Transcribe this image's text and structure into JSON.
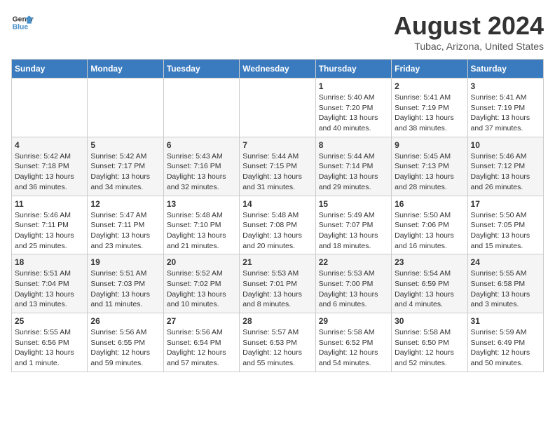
{
  "header": {
    "logo_line1": "General",
    "logo_line2": "Blue",
    "main_title": "August 2024",
    "subtitle": "Tubac, Arizona, United States"
  },
  "days_of_week": [
    "Sunday",
    "Monday",
    "Tuesday",
    "Wednesday",
    "Thursday",
    "Friday",
    "Saturday"
  ],
  "weeks": [
    [
      {
        "day": "",
        "info": ""
      },
      {
        "day": "",
        "info": ""
      },
      {
        "day": "",
        "info": ""
      },
      {
        "day": "",
        "info": ""
      },
      {
        "day": "1",
        "info": "Sunrise: 5:40 AM\nSunset: 7:20 PM\nDaylight: 13 hours\nand 40 minutes."
      },
      {
        "day": "2",
        "info": "Sunrise: 5:41 AM\nSunset: 7:19 PM\nDaylight: 13 hours\nand 38 minutes."
      },
      {
        "day": "3",
        "info": "Sunrise: 5:41 AM\nSunset: 7:19 PM\nDaylight: 13 hours\nand 37 minutes."
      }
    ],
    [
      {
        "day": "4",
        "info": "Sunrise: 5:42 AM\nSunset: 7:18 PM\nDaylight: 13 hours\nand 36 minutes."
      },
      {
        "day": "5",
        "info": "Sunrise: 5:42 AM\nSunset: 7:17 PM\nDaylight: 13 hours\nand 34 minutes."
      },
      {
        "day": "6",
        "info": "Sunrise: 5:43 AM\nSunset: 7:16 PM\nDaylight: 13 hours\nand 32 minutes."
      },
      {
        "day": "7",
        "info": "Sunrise: 5:44 AM\nSunset: 7:15 PM\nDaylight: 13 hours\nand 31 minutes."
      },
      {
        "day": "8",
        "info": "Sunrise: 5:44 AM\nSunset: 7:14 PM\nDaylight: 13 hours\nand 29 minutes."
      },
      {
        "day": "9",
        "info": "Sunrise: 5:45 AM\nSunset: 7:13 PM\nDaylight: 13 hours\nand 28 minutes."
      },
      {
        "day": "10",
        "info": "Sunrise: 5:46 AM\nSunset: 7:12 PM\nDaylight: 13 hours\nand 26 minutes."
      }
    ],
    [
      {
        "day": "11",
        "info": "Sunrise: 5:46 AM\nSunset: 7:11 PM\nDaylight: 13 hours\nand 25 minutes."
      },
      {
        "day": "12",
        "info": "Sunrise: 5:47 AM\nSunset: 7:11 PM\nDaylight: 13 hours\nand 23 minutes."
      },
      {
        "day": "13",
        "info": "Sunrise: 5:48 AM\nSunset: 7:10 PM\nDaylight: 13 hours\nand 21 minutes."
      },
      {
        "day": "14",
        "info": "Sunrise: 5:48 AM\nSunset: 7:08 PM\nDaylight: 13 hours\nand 20 minutes."
      },
      {
        "day": "15",
        "info": "Sunrise: 5:49 AM\nSunset: 7:07 PM\nDaylight: 13 hours\nand 18 minutes."
      },
      {
        "day": "16",
        "info": "Sunrise: 5:50 AM\nSunset: 7:06 PM\nDaylight: 13 hours\nand 16 minutes."
      },
      {
        "day": "17",
        "info": "Sunrise: 5:50 AM\nSunset: 7:05 PM\nDaylight: 13 hours\nand 15 minutes."
      }
    ],
    [
      {
        "day": "18",
        "info": "Sunrise: 5:51 AM\nSunset: 7:04 PM\nDaylight: 13 hours\nand 13 minutes."
      },
      {
        "day": "19",
        "info": "Sunrise: 5:51 AM\nSunset: 7:03 PM\nDaylight: 13 hours\nand 11 minutes."
      },
      {
        "day": "20",
        "info": "Sunrise: 5:52 AM\nSunset: 7:02 PM\nDaylight: 13 hours\nand 10 minutes."
      },
      {
        "day": "21",
        "info": "Sunrise: 5:53 AM\nSunset: 7:01 PM\nDaylight: 13 hours\nand 8 minutes."
      },
      {
        "day": "22",
        "info": "Sunrise: 5:53 AM\nSunset: 7:00 PM\nDaylight: 13 hours\nand 6 minutes."
      },
      {
        "day": "23",
        "info": "Sunrise: 5:54 AM\nSunset: 6:59 PM\nDaylight: 13 hours\nand 4 minutes."
      },
      {
        "day": "24",
        "info": "Sunrise: 5:55 AM\nSunset: 6:58 PM\nDaylight: 13 hours\nand 3 minutes."
      }
    ],
    [
      {
        "day": "25",
        "info": "Sunrise: 5:55 AM\nSunset: 6:56 PM\nDaylight: 13 hours\nand 1 minute."
      },
      {
        "day": "26",
        "info": "Sunrise: 5:56 AM\nSunset: 6:55 PM\nDaylight: 12 hours\nand 59 minutes."
      },
      {
        "day": "27",
        "info": "Sunrise: 5:56 AM\nSunset: 6:54 PM\nDaylight: 12 hours\nand 57 minutes."
      },
      {
        "day": "28",
        "info": "Sunrise: 5:57 AM\nSunset: 6:53 PM\nDaylight: 12 hours\nand 55 minutes."
      },
      {
        "day": "29",
        "info": "Sunrise: 5:58 AM\nSunset: 6:52 PM\nDaylight: 12 hours\nand 54 minutes."
      },
      {
        "day": "30",
        "info": "Sunrise: 5:58 AM\nSunset: 6:50 PM\nDaylight: 12 hours\nand 52 minutes."
      },
      {
        "day": "31",
        "info": "Sunrise: 5:59 AM\nSunset: 6:49 PM\nDaylight: 12 hours\nand 50 minutes."
      }
    ]
  ]
}
